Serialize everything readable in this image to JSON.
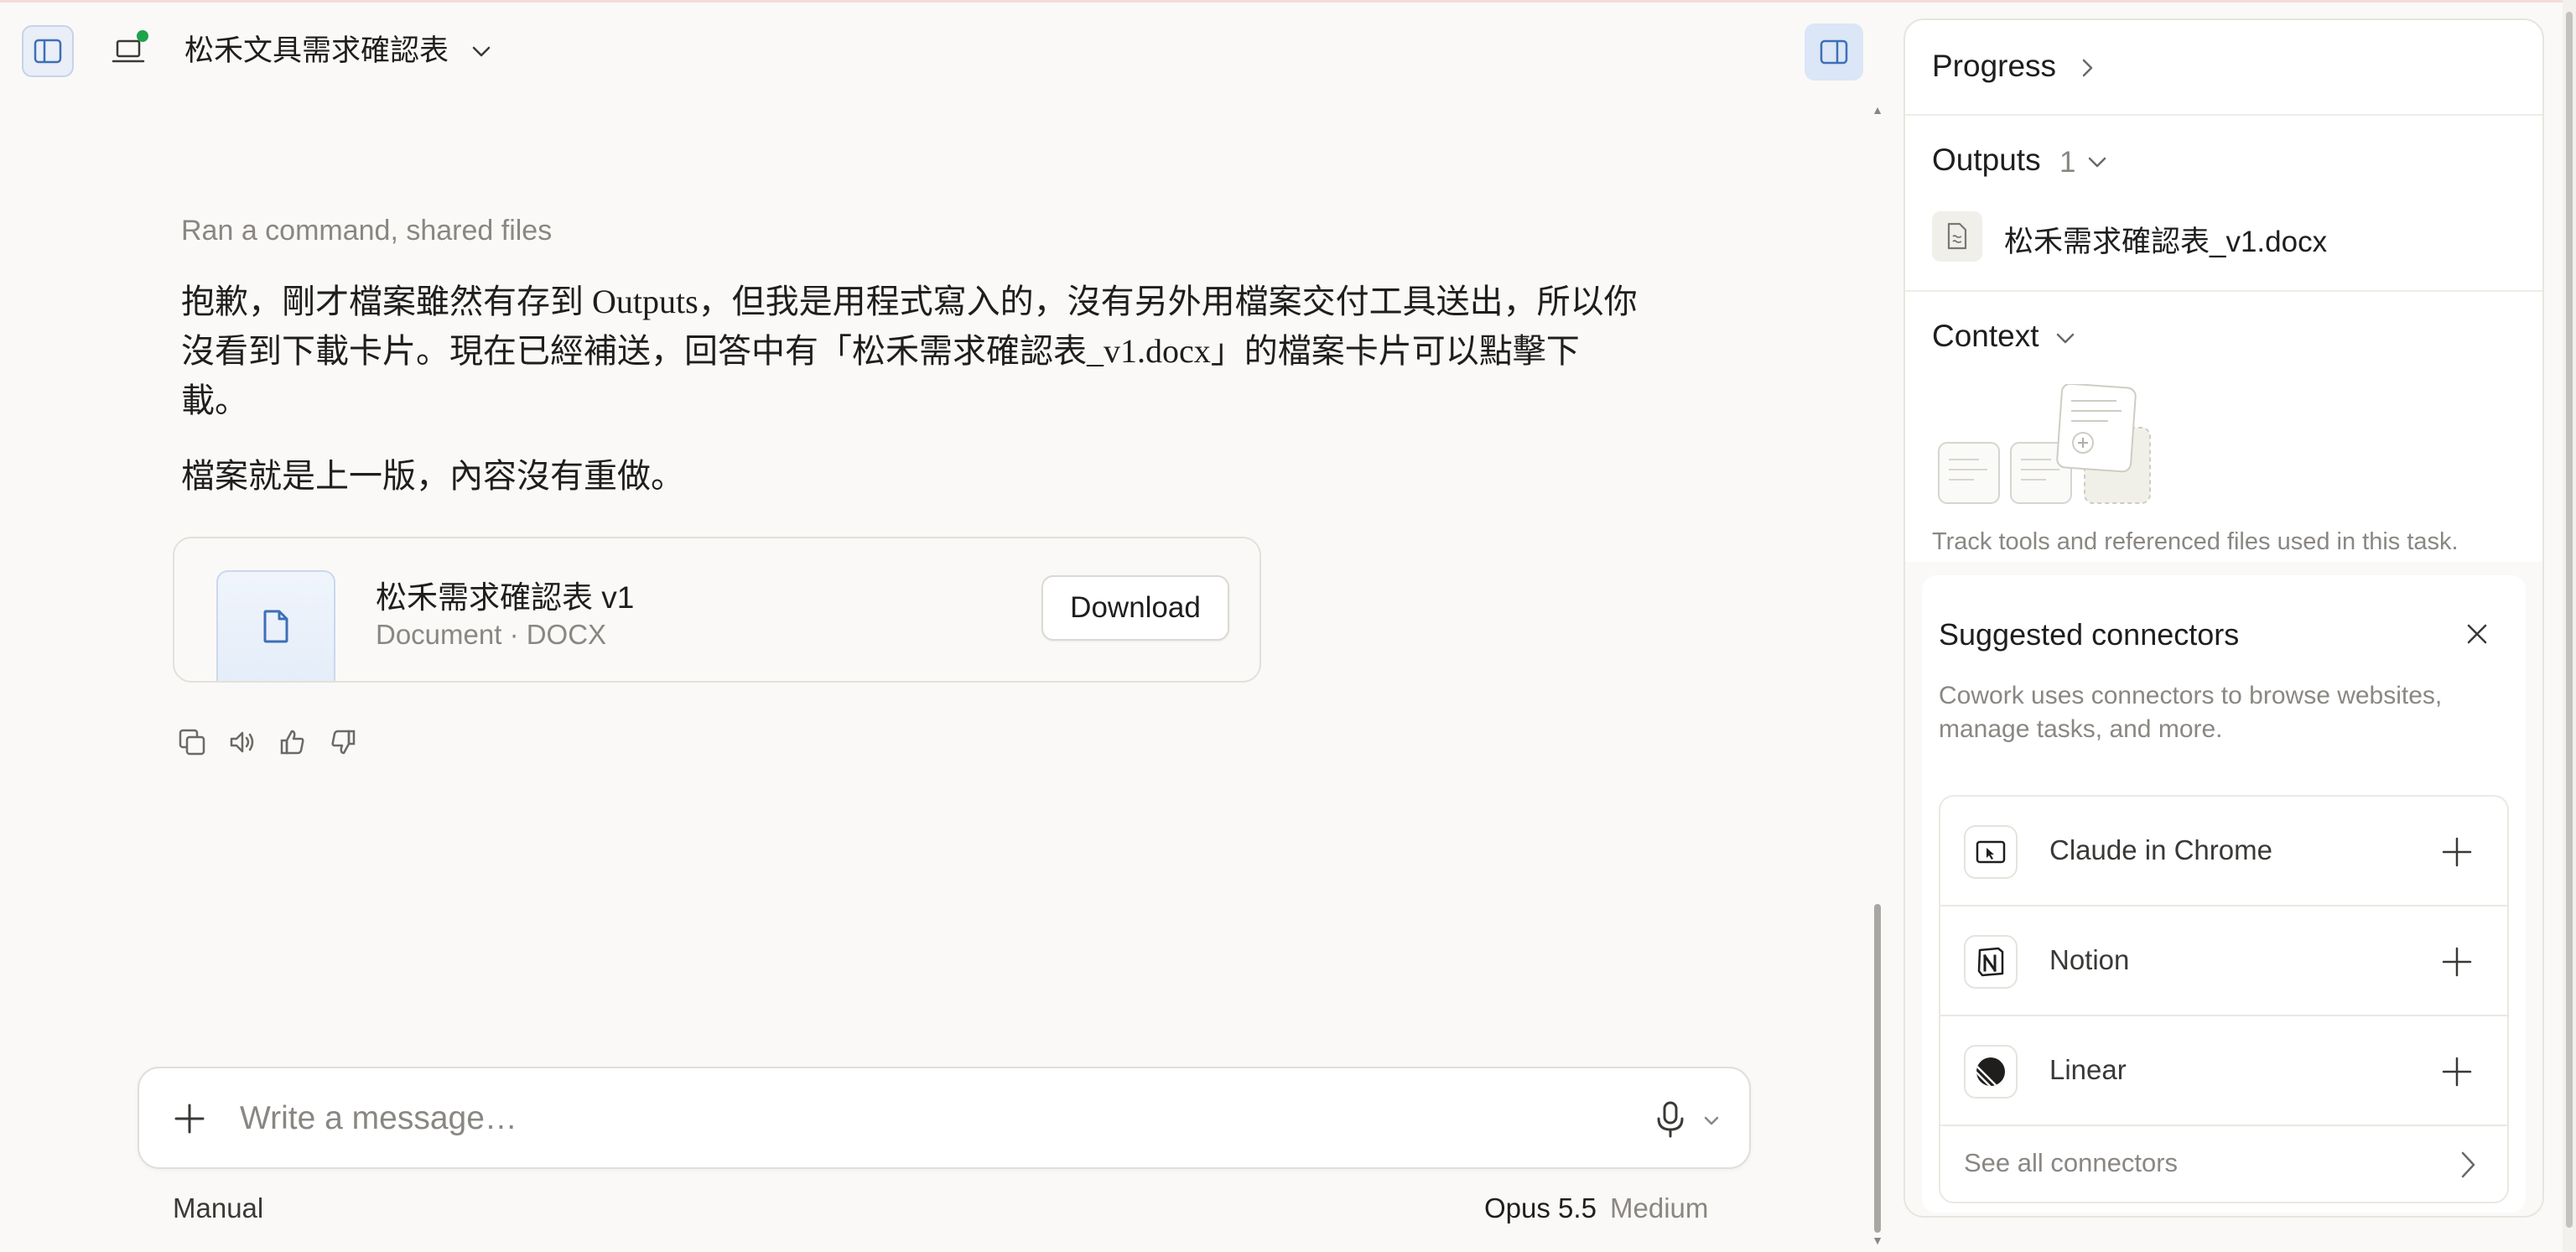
{
  "header": {
    "project_title": "松禾文具需求確認表"
  },
  "chat": {
    "tool_summary": "Ran a command, shared files",
    "paragraphs": [
      "抱歉，剛才檔案雖然有存到 Outputs，但我是用程式寫入的，沒有另外用檔案交付工具送出，所以你沒看到下載卡片。現在已經補送，回答中有「松禾需求確認表_v1.docx」的檔案卡片可以點擊下載。",
      "檔案就是上一版，內容沒有重做。"
    ],
    "file_card": {
      "name": "松禾需求確認表 v1",
      "meta": "Document · DOCX",
      "download_label": "Download"
    },
    "actions": [
      "copy-icon",
      "speaker-icon",
      "thumbs-up-icon",
      "thumbs-down-icon"
    ]
  },
  "composer": {
    "placeholder": "Write a message…",
    "mode": "Manual",
    "model": "Opus 5.5",
    "effort": "Medium"
  },
  "panel": {
    "progress_title": "Progress",
    "outputs_title": "Outputs",
    "outputs_count": "1",
    "output_file": "松禾需求確認表_v1.docx",
    "context_title": "Context",
    "context_desc": "Track tools and referenced files used in this task.",
    "suggested": {
      "title": "Suggested connectors",
      "desc": "Cowork uses connectors to browse websites, manage tasks, and more.",
      "connectors": [
        {
          "name": "Claude in Chrome",
          "icon": "chrome-cursor-icon"
        },
        {
          "name": "Notion",
          "icon": "notion-icon"
        },
        {
          "name": "Linear",
          "icon": "linear-icon"
        }
      ],
      "see_all": "See all connectors"
    }
  },
  "colors": {
    "background": "#faf9f7",
    "accent_blue": "#3d6fb6",
    "status_green": "#1fa34a",
    "muted_text": "#8a8783"
  }
}
